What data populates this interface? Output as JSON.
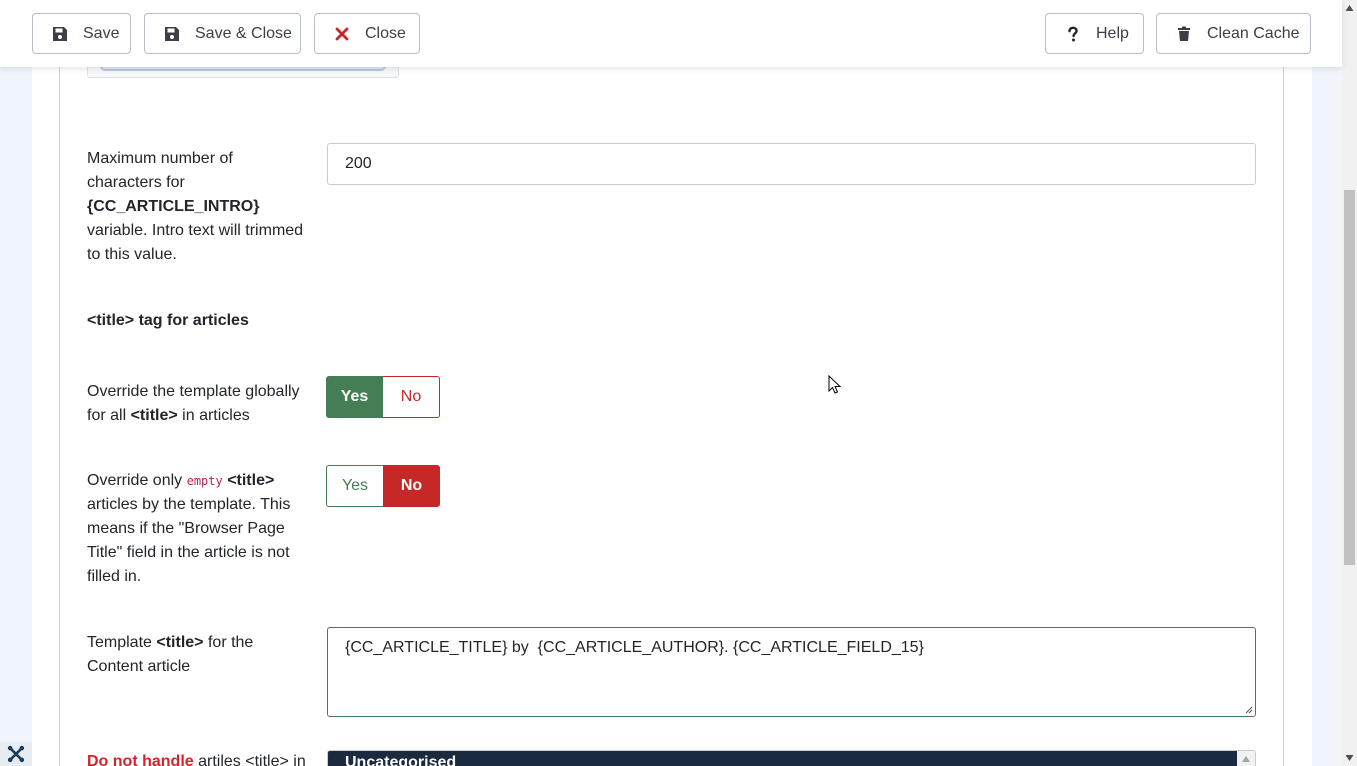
{
  "toolbar": {
    "save_label": "Save",
    "save_close_label": "Save & Close",
    "close_label": "Close",
    "help_label": "Help",
    "clean_cache_label": "Clean Cache"
  },
  "fields": {
    "max_chars": {
      "label_pre": "Maximum number of characters for",
      "label_var": "{CC_ARTICLE_INTRO}",
      "label_post": "variable. Intro text will trimmed to this value.",
      "value": "200"
    },
    "section_heading": "<title> tag for articles",
    "override_global": {
      "label_pre": "Override the template globally for all",
      "label_tag": "<title>",
      "label_post": "in articles",
      "yes_label": "Yes",
      "no_label": "No",
      "selected": "Yes"
    },
    "override_empty": {
      "label_pre": "Override only",
      "label_code": "empty",
      "label_tag": "<title>",
      "label_post": "articles by the template. This means if the \"Browser Page Title\" field in the article is not filled in.",
      "yes_label": "Yes",
      "no_label": "No",
      "selected": "No"
    },
    "template_title": {
      "label_pre": "Template",
      "label_tag": "<title>",
      "label_post": "for the Content article",
      "value": "{CC_ARTICLE_TITLE} by  {CC_ARTICLE_AUTHOR}. {CC_ARTICLE_FIELD_15}"
    },
    "do_not_handle": {
      "label_red": "Do not handle",
      "label_post": "artiles <title> in",
      "selected_option": "Uncategorised"
    }
  },
  "colors": {
    "yes_green": "#457d54",
    "no_red": "#c52827",
    "select_dark": "#1c2a40"
  }
}
